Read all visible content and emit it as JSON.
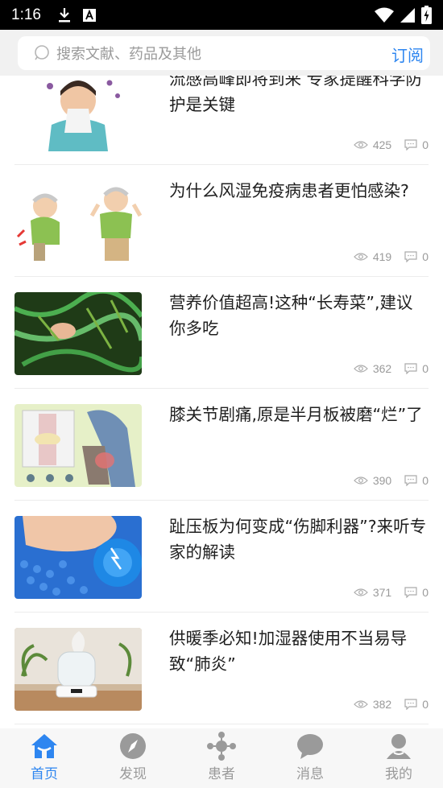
{
  "status_bar": {
    "time": "1:16"
  },
  "search": {
    "placeholder": "搜索文献、药品及其他",
    "subscribe_label": "订阅"
  },
  "articles": [
    {
      "title": "流感高峰即将到来 专家提醒科学防护是关键",
      "views": "425",
      "comments": "0",
      "thumb_icon": "flu-person-illustration"
    },
    {
      "title": "为什么风湿免疫病患者更怕感染?",
      "views": "419",
      "comments": "0",
      "thumb_icon": "elderly-men-illustration"
    },
    {
      "title": "营养价值超高!这种“长寿菜”,建议你多吃",
      "views": "362",
      "comments": "0",
      "thumb_icon": "green-vegetable-photo"
    },
    {
      "title": "膝关节剧痛,原是半月板被磨“烂”了",
      "views": "390",
      "comments": "0",
      "thumb_icon": "knee-pain-illustration"
    },
    {
      "title": "趾压板为何变成“伤脚利器”?来听专家的解读",
      "views": "371",
      "comments": "0",
      "thumb_icon": "foot-massage-board-photo"
    },
    {
      "title": "供暖季必知!加湿器使用不当易导致“肺炎”",
      "views": "382",
      "comments": "0",
      "thumb_icon": "humidifier-photo"
    }
  ],
  "nav": [
    {
      "label": "首页",
      "icon": "home-icon",
      "active": true
    },
    {
      "label": "发现",
      "icon": "compass-icon",
      "active": false
    },
    {
      "label": "患者",
      "icon": "patients-icon",
      "active": false
    },
    {
      "label": "消息",
      "icon": "message-icon",
      "active": false
    },
    {
      "label": "我的",
      "icon": "profile-icon",
      "active": false
    }
  ],
  "colors": {
    "accent": "#2e86f0",
    "inactive": "#9a9a9a"
  }
}
